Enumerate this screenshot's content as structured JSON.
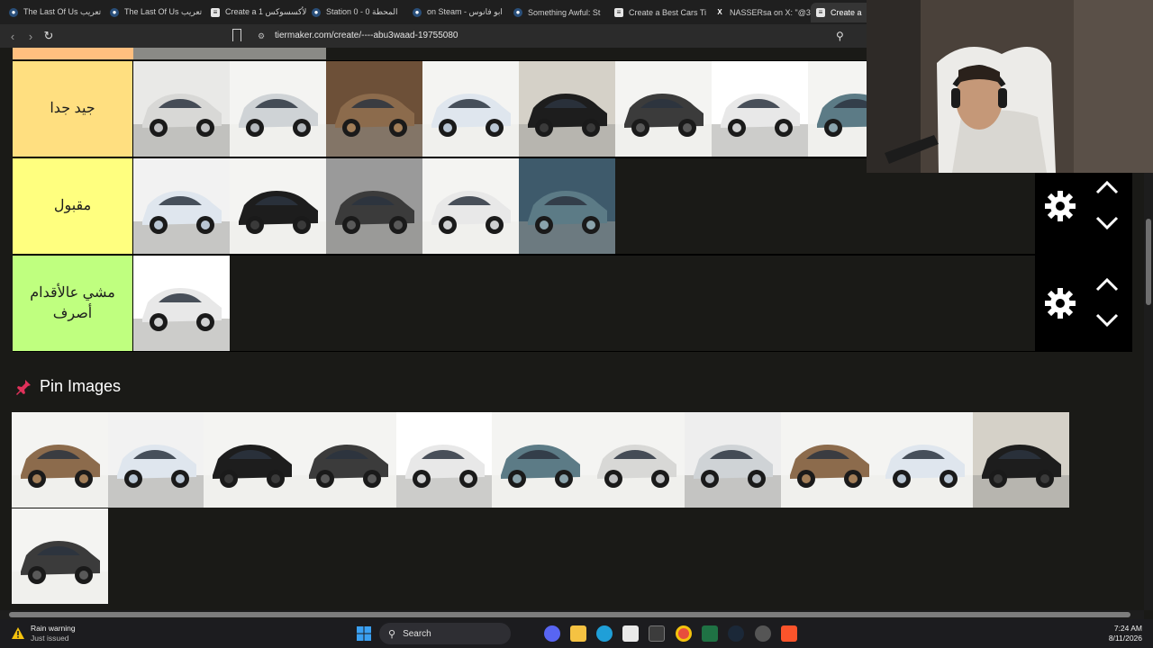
{
  "browser": {
    "tabs": [
      {
        "label": "The Last Of Us تعريب",
        "icon": "steam-icon",
        "active": false
      },
      {
        "label": "The Last Of Us تعريب",
        "icon": "steam-icon",
        "active": false
      },
      {
        "label": "Create a 1 الأكسسوكس",
        "icon": "tiermaker-icon",
        "active": false
      },
      {
        "label": "Station 0 - 0 المحطة",
        "icon": "steam-icon",
        "active": false
      },
      {
        "label": "on Steam - ابو فانوس",
        "icon": "steam-icon",
        "active": false
      },
      {
        "label": "Something Awful: St",
        "icon": "steam-icon",
        "active": false
      },
      {
        "label": "Create a Best Cars Ti",
        "icon": "tiermaker-icon",
        "active": false
      },
      {
        "label": "NASSERsa on X: \"@3",
        "icon": "x-icon",
        "active": false
      },
      {
        "label": "Create a",
        "icon": "tiermaker-icon",
        "active": true
      }
    ],
    "url": "tiermaker.com/create/----abu3waad-19755080"
  },
  "tiers": [
    {
      "label_lines": [
        "جيد جدا"
      ],
      "color": "#ffdf80",
      "item_count": 8,
      "has_controls": false
    },
    {
      "label_lines": [
        "مقبول"
      ],
      "color": "#ffff7f",
      "item_count": 5,
      "has_controls": true
    },
    {
      "label_lines": [
        "مشي عالأقدام",
        "أصرف"
      ],
      "color": "#bfff7f",
      "item_count": 1,
      "has_controls": true
    }
  ],
  "pin_section": {
    "title": "Pin Images",
    "item_count": 12
  },
  "taskbar": {
    "weather_title": "Rain warning",
    "weather_sub": "Just issued",
    "search_label": "Search",
    "time": "7:24 AM",
    "date": "8/11/2026"
  }
}
